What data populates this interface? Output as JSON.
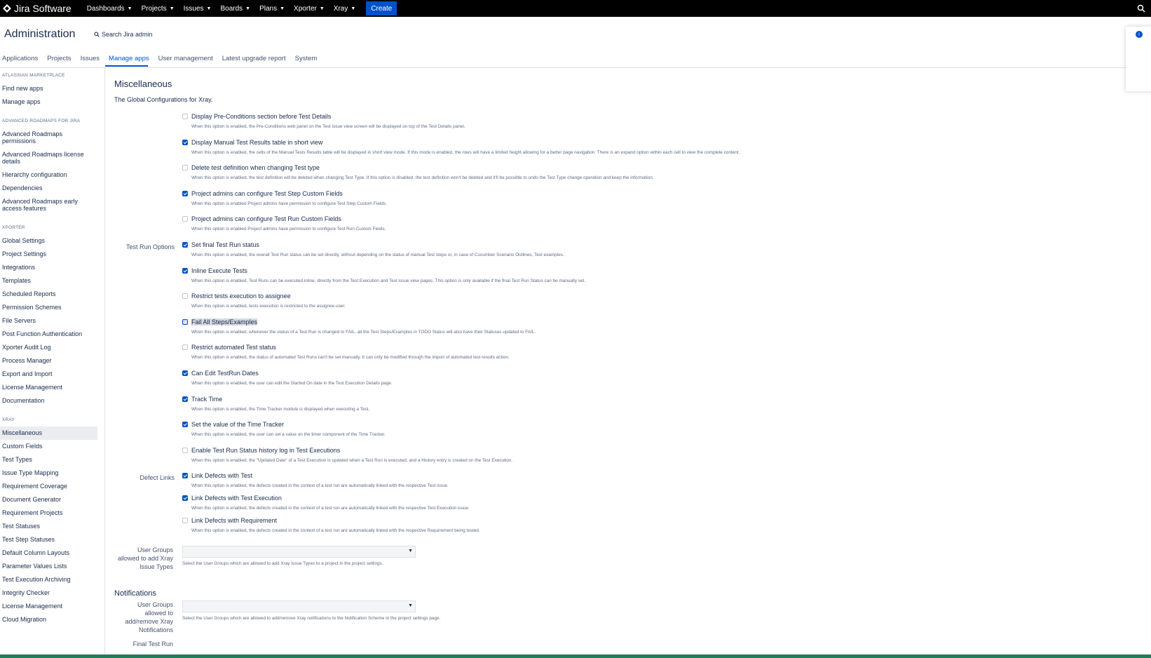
{
  "topbar": {
    "brand": "Jira Software",
    "nav": [
      "Dashboards",
      "Projects",
      "Issues",
      "Boards",
      "Plans",
      "Xporter",
      "Xray"
    ],
    "create_label": "Create"
  },
  "admin": {
    "title": "Administration",
    "search_label": "Search Jira admin",
    "tabs": [
      "Applications",
      "Projects",
      "Issues",
      "Manage apps",
      "User management",
      "Latest upgrade report",
      "System"
    ]
  },
  "sidebar": {
    "groups": [
      {
        "heading": "ATLASSIAN MARKETPLACE",
        "items": [
          "Find new apps",
          "Manage apps"
        ]
      },
      {
        "heading": "ADVANCED ROADMAPS FOR JIRA",
        "items": [
          "Advanced Roadmaps permissions",
          "Advanced Roadmaps license details",
          "Hierarchy configuration",
          "Dependencies",
          "Advanced Roadmaps early access features"
        ]
      },
      {
        "heading": "XPORTER",
        "items": [
          "Global Settings",
          "Project Settings",
          "Integrations",
          "Templates",
          "Scheduled Reports",
          "Permission Schemes",
          "File Servers",
          "Post Function Authentication",
          "Xporter Audit Log",
          "Process Manager",
          "Export and Import",
          "License Management",
          "Documentation"
        ]
      },
      {
        "heading": "XRAY",
        "items": [
          "Miscellaneous",
          "Custom Fields",
          "Test Types",
          "Issue Type Mapping",
          "Requirement Coverage",
          "Document Generator",
          "Requirement Projects",
          "Test Statuses",
          "Test Step Statuses",
          "Default Column Layouts",
          "Parameter Values Lists",
          "Test Execution Archiving",
          "Integrity Checker",
          "License Management",
          "Cloud Migration"
        ]
      }
    ]
  },
  "main": {
    "title": "Miscellaneous",
    "description": "The Global Configurations for Xray.",
    "options": [
      {
        "label": "Display Pre-Conditions section before Test Details",
        "checked": false,
        "desc": "When this option is enabled, the Pre-Conditions web panel on the Test issue view screen will be displayed on top of the Test Details panel."
      },
      {
        "label": "Display Manual Test Results table in short view",
        "checked": true,
        "desc": "When this option is enabled, the cells of the Manual Tests Results table will be displayed in short view mode. If this mode is enabled, the rows will have a limited height allowing for a better page navigation. There is an expand option within each cell to view the complete content."
      },
      {
        "label": "Delete test definition when changing Test type",
        "checked": false,
        "desc": "When this option is enabled, the test definition will be deleted when changing Test Type. If this option is disabled, the test definition won't be deleted and it'll be possible to undo the Test Type change operation and keep the information."
      },
      {
        "label": "Project admins can configure Test Step Custom Fields",
        "checked": true,
        "desc": "When this option is enabled Project admins have permission to configure Test Step Custom Fields."
      },
      {
        "label": "Project admins can configure Test Run Custom Fields",
        "checked": false,
        "desc": "When this option is enabled Project admins have permission to configure Test Run Custom Fields."
      },
      {
        "group": "Test Run Options",
        "label": "Set final Test Run status",
        "checked": true,
        "desc": "When this option is enabled, the overall Test Run status can be set directly, without depending on the status of manual Test steps or, in case of Cucumber Scenario Outlines, Test examples."
      },
      {
        "label": "Inline Execute Tests",
        "checked": true,
        "desc": "When this option is enabled, Test Runs can be executed inline, directly from the Test Execution and Test issue view pages. This option is only available if the final Test Run Status can be manually set."
      },
      {
        "label": "Restrict tests execution to assignee",
        "checked": false,
        "desc": "When this option is enabled, tests execution is restricted to the assignee user."
      },
      {
        "label": "Fail All Steps/Examples",
        "checked": true,
        "highlight": true,
        "desc": "When this option is enabled, whenever the status of a Test Run is changed to FAIL, all the Test Steps/Examples in TODO Status will also have their Statuses updated to FAIL."
      },
      {
        "label": "Restrict automated Test status",
        "checked": false,
        "desc": "When this option is enabled, the status of automated Test Runs can't be set manually. It can only be modified through the import of automated test results action."
      },
      {
        "label": "Can Edit TestRun Dates",
        "checked": true,
        "desc": "When this option is enabled, the user can edit the Started On date in the Test Execution Details page."
      },
      {
        "label": "Track Time",
        "checked": true,
        "desc": "When this option is enabled, the Time Tracker module is displayed when executing a Test."
      },
      {
        "label": "Set the value of the Time Tracker",
        "checked": true,
        "desc": "When this option is enabled, the user can set a value on the timer component of the Time Tracker."
      },
      {
        "label": "Enable Test Run Status history log in Test Executions",
        "checked": false,
        "desc": "When this option is enabled, the \"Updated Date\" of a Test Execution is updated when a Test Run is executed, and a History entry is created on the Test Execution."
      },
      {
        "group": "Defect Links",
        "label": "Link Defects with Test",
        "checked": true,
        "desc": "When this option is enabled, the defects created in the context of a test run are automatically linked with the respective Test issue."
      },
      {
        "label": "Link Defects with Test Execution",
        "checked": true,
        "desc": "When this option is enabled, the defects created in the context of a test run are automatically linked with the respective Test Execution issue."
      },
      {
        "label": "Link Defects with Requirement",
        "checked": false,
        "desc": "When this option is enabled, the defects created in the context of a test run are automatically linked with the respective Requirement being tested."
      }
    ],
    "user_groups": {
      "label": "User Groups allowed to add Xray Issue Types",
      "desc": "Select the User Groups which are allowed to add Xray Issue Types to a project in the project settings."
    },
    "notifications": {
      "title": "Notifications",
      "label": "User Groups allowed to add/remove Xray Notifications",
      "desc": "Select the User Groups which are allowed to add/remove Xray notifications to the Notification Scheme in the project settings page.",
      "next_label": "Final Test Run"
    }
  }
}
